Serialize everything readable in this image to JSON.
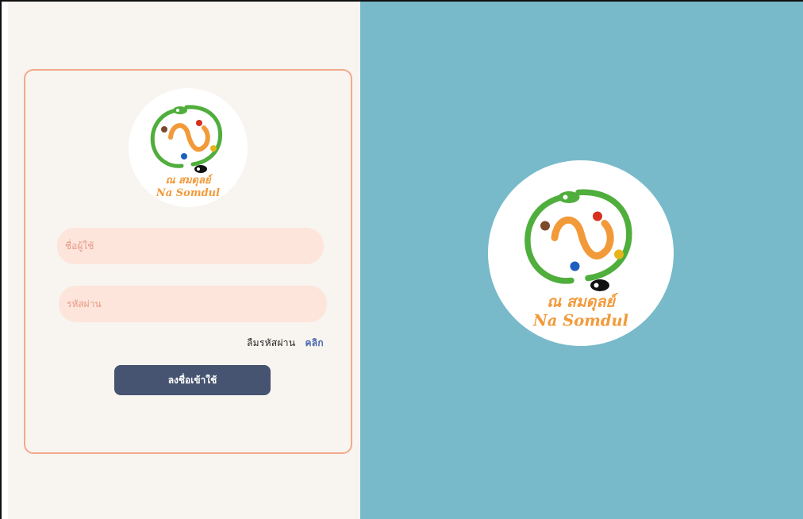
{
  "brand": {
    "logo_text_thai": "ณ สมดุลย์",
    "logo_text_en": "Na Somdul"
  },
  "login_form": {
    "username_placeholder": "ชื่อผู้ใช้",
    "password_placeholder": "รหัสผ่าน",
    "forgot_password_label": "ลืมรหัสผ่าน",
    "forgot_password_link": "คลิก",
    "submit_label": "ลงชื่อเข้าใช้"
  },
  "colors": {
    "left_background": "#f8f4f0",
    "right_background": "#78bac9",
    "card_border": "#f3a98b",
    "input_background": "#fde5dc",
    "button_background": "#465371",
    "link": "#4a66b0",
    "logo_orange": "#f29a3a",
    "logo_green": "#4fae3c"
  },
  "icons": [
    "na-somdul-logo-icon"
  ]
}
